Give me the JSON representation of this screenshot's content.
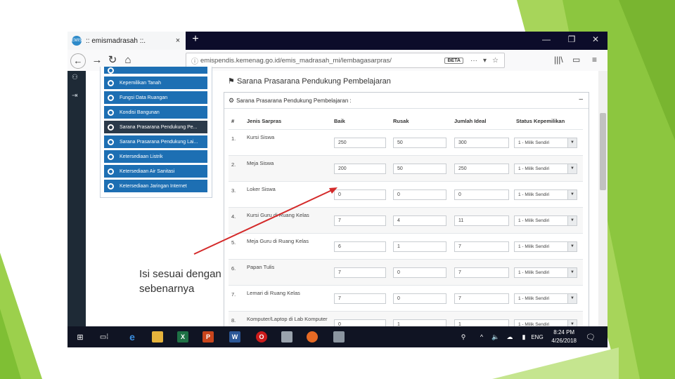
{
  "browser": {
    "tab_title": ":: emismadrasah ::.",
    "tab_favicon": "EMIS",
    "url": "emispendis.kemenag.go.id/emis_madrasah_mi/lembagasarpras/",
    "url_badge": "BETA",
    "new_tab": "+",
    "tab_close": "×",
    "win_min": "—",
    "win_max": "❐",
    "win_close": "✕"
  },
  "sidebar": {
    "items": [
      {
        "label": ""
      },
      {
        "label": "Kepemilikan Tanah"
      },
      {
        "label": "Fungsi Data Ruangan"
      },
      {
        "label": "Kondisi Bangunan"
      },
      {
        "label": "Sarana Prasarana Pendukung Pe...",
        "active": true
      },
      {
        "label": "Sarana Prasarana Pendukung Lai..."
      },
      {
        "label": "Ketersediaan Listrik"
      },
      {
        "label": "Ketersediaan Air Sanitasi"
      },
      {
        "label": "Ketersediaan Jaringan Internet"
      }
    ]
  },
  "page": {
    "title": "Sarana Prasarana Pendukung Pembelajaran",
    "panel_title": "Sarana Prasarana Pendukung Pembelajaran :",
    "panel_toggle": "–"
  },
  "table": {
    "headers": [
      "#",
      "Jenis Sarpras",
      "Baik",
      "Rusak",
      "Jumlah Ideal",
      "Status Kepemilikan"
    ],
    "rows": [
      {
        "no": "1.",
        "jenis": "Kursi Siswa",
        "baik": "250",
        "rusak": "50",
        "ideal": "300",
        "status": "1 - Milik Sendiri"
      },
      {
        "no": "2.",
        "jenis": "Meja Siswa",
        "baik": "200",
        "rusak": "50",
        "ideal": "250",
        "status": "1 - Milik Sendiri"
      },
      {
        "no": "3.",
        "jenis": "Loker Siswa",
        "baik": "0",
        "rusak": "0",
        "ideal": "0",
        "status": "1 - Milik Sendiri"
      },
      {
        "no": "4.",
        "jenis": "Kursi Guru di Ruang Kelas",
        "baik": "7",
        "rusak": "4",
        "ideal": "11",
        "status": "1 - Milik Sendiri"
      },
      {
        "no": "5.",
        "jenis": "Meja Guru di Ruang Kelas",
        "baik": "6",
        "rusak": "1",
        "ideal": "7",
        "status": "1 - Milik Sendiri"
      },
      {
        "no": "6.",
        "jenis": "Papan Tulis",
        "baik": "7",
        "rusak": "0",
        "ideal": "7",
        "status": "1 - Milik Sendiri"
      },
      {
        "no": "7.",
        "jenis": "Lemari di Ruang Kelas",
        "baik": "7",
        "rusak": "0",
        "ideal": "7",
        "status": "1 - Milik Sendiri"
      },
      {
        "no": "8.",
        "jenis": "Komputer/Laptop di Lab Komputer",
        "baik": "0",
        "rusak": "1",
        "ideal": "1",
        "status": "1 - Milik Sendiri"
      }
    ]
  },
  "taskbar": {
    "time": "8:24 PM",
    "date": "4/26/2018",
    "lang": "ENG"
  },
  "annotation": {
    "line1": "Isi sesuai dengan",
    "line2": "sebenarnya"
  },
  "colors": {
    "accent_green": "#8cc63f",
    "sidebar_blue": "#1d6fb3",
    "arrow_red": "#d42a2a"
  }
}
